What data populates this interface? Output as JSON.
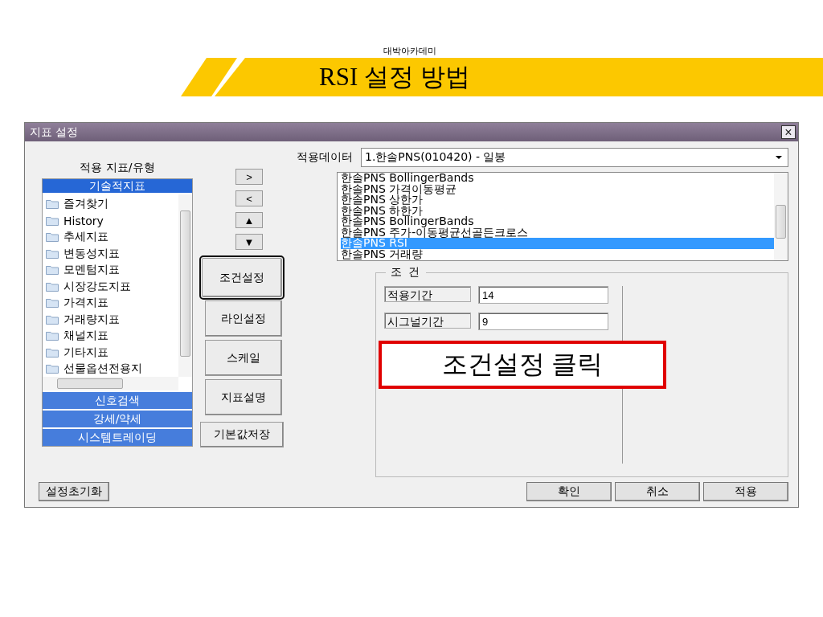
{
  "slide": {
    "subtitle": "대박아카데미",
    "title": "RSI 설정 방법"
  },
  "dialog": {
    "title": "지표 설정",
    "close": "×"
  },
  "left_panel": {
    "label": "적용 지표/유형",
    "groups": [
      {
        "label": "기술적지표",
        "expanded": true,
        "items": [
          "즐겨찾기",
          "History",
          "추세지표",
          "변동성지표",
          "모멘텀지표",
          "시장강도지표",
          "가격지표",
          "거래량지표",
          "채널지표",
          "기타지표",
          "선물옵션전용지"
        ]
      },
      {
        "label": "신호검색",
        "expanded": false
      },
      {
        "label": "강세/약세",
        "expanded": false
      },
      {
        "label": "시스템트레이딩",
        "expanded": false
      }
    ]
  },
  "move_buttons": [
    ">",
    "<",
    "▲",
    "▼"
  ],
  "side_buttons": [
    {
      "label": "조건설정",
      "circled": true
    },
    {
      "label": "라인설정",
      "circled": false
    },
    {
      "label": "스케일",
      "circled": false
    },
    {
      "label": "지표설명",
      "circled": false
    },
    {
      "label": "기본값저장",
      "circled": false
    }
  ],
  "data_label": "적용데이터",
  "data_value": "1.한솔PNS(010420) - 일봉",
  "indicators": [
    {
      "label": "한솔PNS BollingerBands",
      "selected": false
    },
    {
      "label": "한솔PNS 가격이동평균",
      "selected": false
    },
    {
      "label": "한솔PNS 상한가",
      "selected": false
    },
    {
      "label": "한솔PNS 하한가",
      "selected": false
    },
    {
      "label": "한솔PNS BollingerBands",
      "selected": false
    },
    {
      "label": "한솔PNS 주가-이동평균선골든크로스",
      "selected": false
    },
    {
      "label": "한솔PNS RSI",
      "selected": true
    },
    {
      "label": "한솔PNS 거래량",
      "selected": false
    }
  ],
  "condition": {
    "legend": "조 건",
    "fields": [
      {
        "label": "적용기간",
        "value": "14"
      },
      {
        "label": "시그널기간",
        "value": "9"
      }
    ]
  },
  "callout": "조건설정 클릭",
  "reset_button": "설정초기화",
  "buttons": [
    "확인",
    "취소",
    "적용"
  ]
}
